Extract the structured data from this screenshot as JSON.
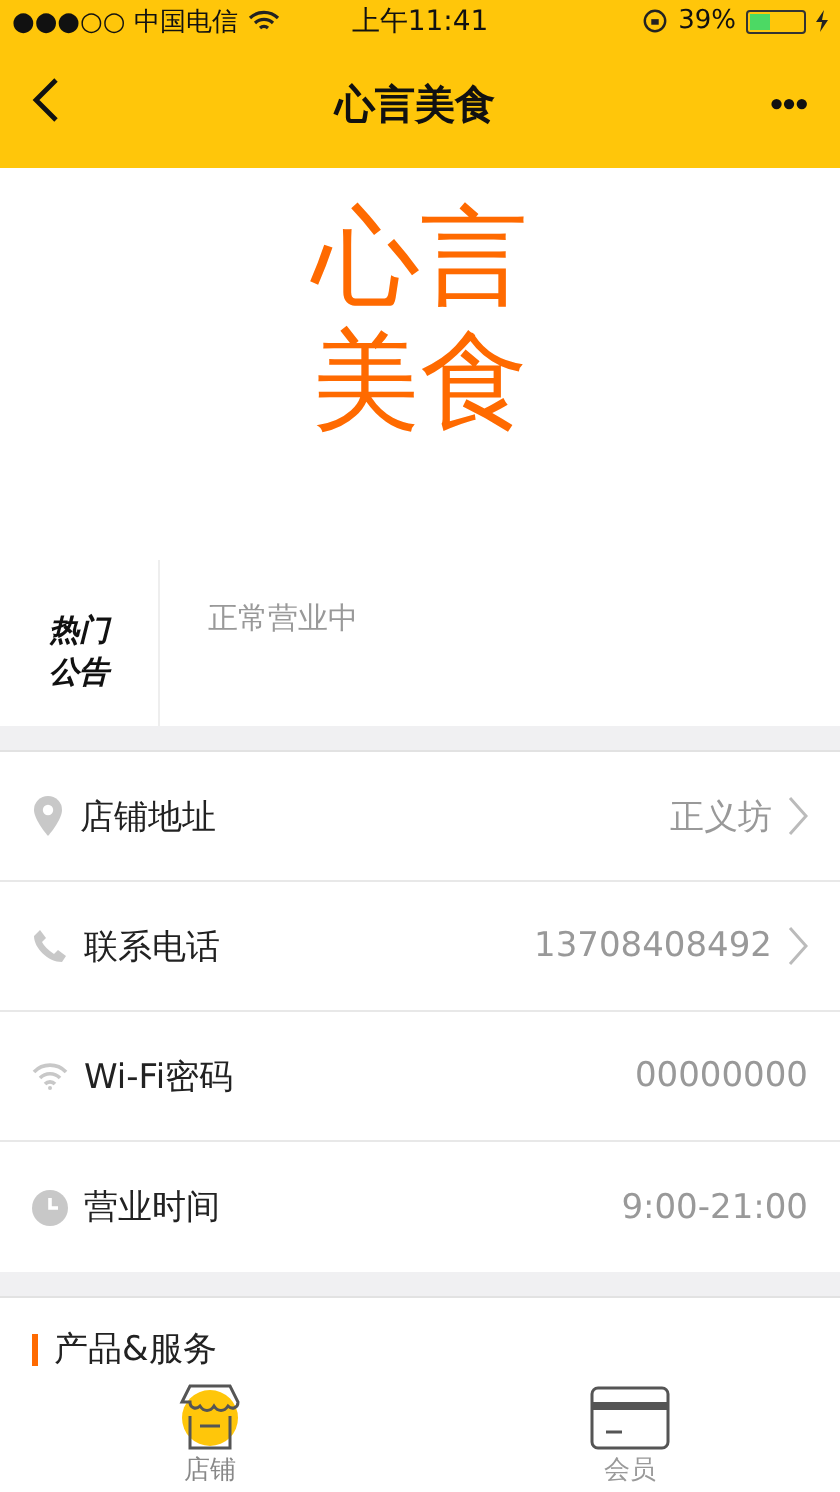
{
  "status_bar": {
    "carrier": "●●●○○ 中国电信",
    "time": "上午11:41",
    "battery": "39%",
    "level": 0.39
  },
  "nav": {
    "title": "心言美食",
    "more": "•••"
  },
  "logo": {
    "lines": [
      "心言",
      "美食"
    ]
  },
  "notice": {
    "label_lines": [
      "热门",
      "公告"
    ],
    "text": "正常营业中"
  },
  "info_rows": [
    {
      "kind": "location",
      "label": "店铺地址",
      "value": "正义坊",
      "chevron": true
    },
    {
      "kind": "phone",
      "label": "联系电话",
      "value": "13708408492",
      "chevron": true
    },
    {
      "kind": "wifi",
      "label": "Wi-Fi密码",
      "value": "00000000",
      "chevron": false
    },
    {
      "kind": "clock",
      "label": "营业时间",
      "value": "9:00-21:00",
      "chevron": false
    }
  ],
  "section": {
    "title": "产品&服务"
  },
  "tab_bar": [
    {
      "kind": "shop",
      "label": "店铺",
      "selected": true
    },
    {
      "kind": "card",
      "label": "会员",
      "selected": false
    }
  ]
}
